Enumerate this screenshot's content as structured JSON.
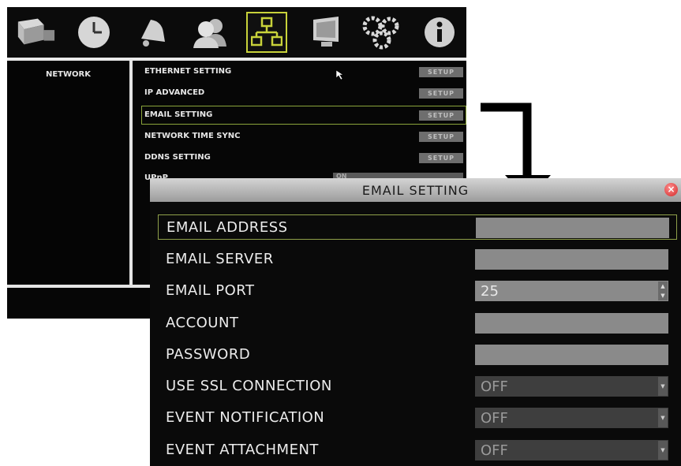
{
  "toolbar": {
    "icons": [
      "camera-icon",
      "clock-icon",
      "alarm-bell-icon",
      "users-icon",
      "network-icon",
      "monitor-icon",
      "gears-icon",
      "info-icon"
    ],
    "active": "network-icon",
    "active_color": "#c8d23a"
  },
  "sidebar": {
    "title": "NETWORK"
  },
  "network_menu": {
    "items": [
      {
        "label": "ETHERNET SETTING",
        "button": "SETUP"
      },
      {
        "label": "IP ADVANCED",
        "button": "SETUP"
      },
      {
        "label": "EMAIL SETTING",
        "button": "SETUP",
        "selected": true
      },
      {
        "label": "NETWORK TIME SYNC",
        "button": "SETUP"
      },
      {
        "label": "DDNS SETTING",
        "button": "SETUP"
      }
    ],
    "partial_row": {
      "label": "UPnP",
      "value": "ON"
    }
  },
  "dialog": {
    "title": "EMAIL SETTING",
    "close": "×",
    "rows": [
      {
        "label": "EMAIL ADDRESS",
        "value": "",
        "type": "text",
        "selected": true
      },
      {
        "label": "EMAIL SERVER",
        "value": "",
        "type": "text"
      },
      {
        "label": "EMAIL PORT",
        "value": "25",
        "type": "spinner"
      },
      {
        "label": "ACCOUNT",
        "value": "",
        "type": "text"
      },
      {
        "label": "PASSWORD",
        "value": "",
        "type": "password"
      },
      {
        "label": "USE SSL CONNECTION",
        "value": "OFF",
        "type": "select"
      },
      {
        "label": "EVENT NOTIFICATION",
        "value": "OFF",
        "type": "select"
      },
      {
        "label": "EVENT ATTACHMENT",
        "value": "OFF",
        "type": "select"
      }
    ]
  },
  "colors": {
    "selection_border": "#8fa04a",
    "background": "#0a0a0a",
    "field": "#8a8a8a"
  }
}
